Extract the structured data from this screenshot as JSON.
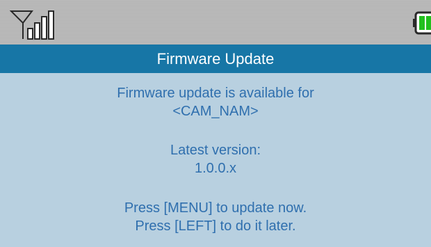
{
  "status_bar": {
    "signal_icon": "signal-strength-icon",
    "battery_icon": "battery-icon",
    "battery_color": "#22c01e"
  },
  "title": "Firmware Update",
  "message": {
    "line1": "Firmware update is available for",
    "line2": "<CAM_NAM>",
    "line3": "Latest version:",
    "line4": "1.0.0.x",
    "line5": "Press [MENU] to update now.",
    "line6": "Press [LEFT] to do it later."
  },
  "colors": {
    "title_bar": "#1776a6",
    "background": "#b8d0e0",
    "text": "#2f6fae"
  }
}
